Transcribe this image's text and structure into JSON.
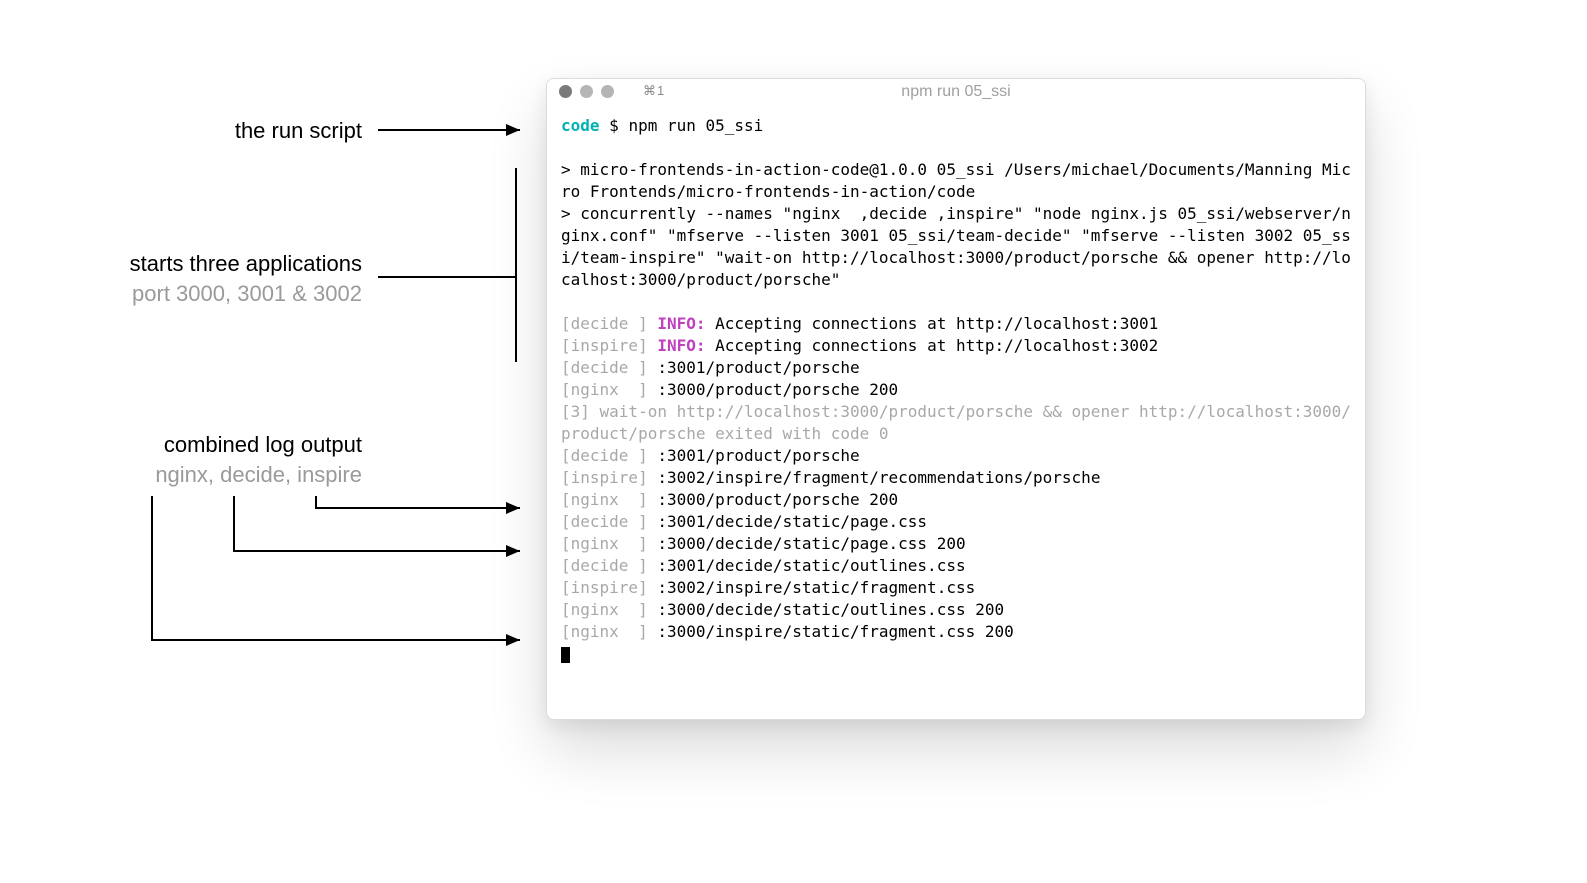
{
  "annotations": {
    "run_script": {
      "line1": "the run script"
    },
    "three_apps": {
      "line1": "starts three applications",
      "line2": "port 3000, 3001 & 3002"
    },
    "logs": {
      "line1": "combined log output",
      "line2": "nginx, decide, inspire"
    }
  },
  "window": {
    "tab_shortcut": "⌘1",
    "title": "npm run 05_ssi"
  },
  "prompt": {
    "label": "code",
    "symbol": "$",
    "cmd": "npm run 05_ssi"
  },
  "output": {
    "l1": "> micro-frontends-in-action-code@1.0.0 05_ssi /Users/michael/Documents/Manning Micro Frontends/micro-frontends-in-action/code",
    "l2": "> concurrently --names \"nginx  ,decide ,inspire\" \"node nginx.js 05_ssi/webserver/nginx.conf\" \"mfserve --listen 3001 05_ssi/team-decide\" \"mfserve --listen 3002 05_ssi/team-inspire\" \"wait-on http://localhost:3000/product/porsche && opener http://localhost:3000/product/porsche\"",
    "decide_tag": "[decide ]",
    "inspire_tag": "[inspire]",
    "nginx_tag": "[nginx  ]",
    "info": "INFO:",
    "info_decide": " Accepting connections at http://localhost:3001",
    "info_inspire": " Accepting connections at http://localhost:3002",
    "p_decide1": " :3001/product/porsche",
    "p_nginx1": " :3000/product/porsche 200",
    "l_wait": "[3] wait-on http://localhost:3000/product/porsche && opener http://localhost:3000/product/porsche exited with code 0",
    "p_decide2": " :3001/product/porsche",
    "p_inspire1": " :3002/inspire/fragment/recommendations/porsche",
    "p_nginx2": " :3000/product/porsche 200",
    "p_decide3": " :3001/decide/static/page.css",
    "p_nginx3": " :3000/decide/static/page.css 200",
    "p_decide4": " :3001/decide/static/outlines.css",
    "p_inspire2": " :3002/inspire/static/fragment.css",
    "p_nginx4": " :3000/decide/static/outlines.css 200",
    "p_nginx5": " :3000/inspire/static/fragment.css 200"
  }
}
